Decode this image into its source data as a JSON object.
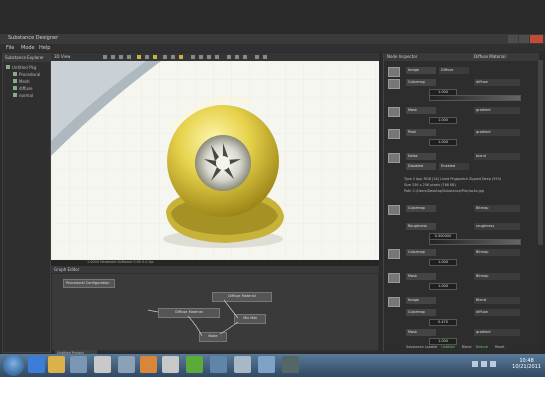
{
  "window": {
    "title": "Substance Designer"
  },
  "menu": [
    "File",
    "Mode",
    "Help"
  ],
  "explorer": {
    "header": "Substance Explorer",
    "items": [
      "Untitled Pkg",
      "Procedural",
      "Mesh",
      "diffuse",
      "normal"
    ]
  },
  "viewport": {
    "title": "3D View",
    "status": "1.0000 Hardware  Software 0.00  0.0 fps"
  },
  "graph": {
    "header": "Graph Editor",
    "tab": "Procedural Configuration",
    "nodes": [
      "Diffuse Material",
      "Diffuse Material",
      "Mix Mat",
      "Node"
    ],
    "bottom_tab": "Untitled Project"
  },
  "inspector": {
    "header": "Node Inspector",
    "dropdown": "Diffuse Material",
    "props": [
      {
        "label": "Image",
        "value": "Diffuse"
      },
      {
        "label": "Colormap",
        "value": "diffuse"
      },
      {
        "label": "Mask",
        "value": "gradient"
      },
      {
        "label": "Pixel",
        "value": "gradient"
      },
      {
        "label": "Noise",
        "value": "blend"
      },
      {
        "label": "Disabled",
        "value": "Enabled"
      },
      {
        "label": "Colormap",
        "value": "Bitmap"
      },
      {
        "label": "Roughness",
        "value": "roughness"
      },
      {
        "label": "Colormap",
        "value": "Bitmap"
      },
      {
        "label": "Mask",
        "value": "Bitmap"
      },
      {
        "label": "Image",
        "value": "Blend"
      },
      {
        "label": "Colormap",
        "value": "diffuse"
      },
      {
        "label": "Mask",
        "value": "gradient"
      }
    ],
    "numbers": [
      "1.000",
      "1.000",
      "1.000",
      "0.500000",
      "1.000",
      "1.000",
      "0.470",
      "1.000"
    ],
    "info": [
      "Type    2 bpp RGB (24) Lined Pngspatch Zipped Deep (555)",
      "Size     256 x 256 pixels (768 KB)",
      "Path     C:/Users/Desktop/Substance/File/rocks.jpg"
    ],
    "status": [
      "Substance Loaded",
      "Untitled",
      "Blend",
      "Texture",
      "Reset"
    ]
  },
  "taskbar": {
    "time": "10:48",
    "date": "10/21/2011"
  },
  "colors": {
    "ball": "#e6d24a",
    "ball_dark": "#b39d1e",
    "floor": "#f4f4ee"
  }
}
